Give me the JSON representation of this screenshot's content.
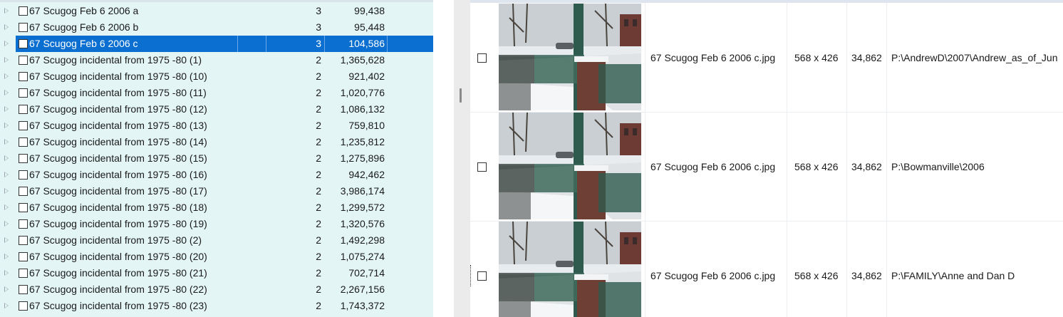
{
  "groups": [
    {
      "name": "67 Scugog Feb 6 2006 a",
      "count": "3",
      "size": "99,438",
      "selected": false
    },
    {
      "name": "67 Scugog Feb 6 2006 b",
      "count": "3",
      "size": "95,448",
      "selected": false
    },
    {
      "name": "67 Scugog Feb 6 2006 c",
      "count": "3",
      "size": "104,586",
      "selected": true
    },
    {
      "name": "67 Scugog incidental from 1975 -80 (1)",
      "count": "2",
      "size": "1,365,628",
      "selected": false
    },
    {
      "name": "67 Scugog incidental from 1975 -80 (10)",
      "count": "2",
      "size": "921,402",
      "selected": false
    },
    {
      "name": "67 Scugog incidental from 1975 -80 (11)",
      "count": "2",
      "size": "1,020,776",
      "selected": false
    },
    {
      "name": "67 Scugog incidental from 1975 -80 (12)",
      "count": "2",
      "size": "1,086,132",
      "selected": false
    },
    {
      "name": "67 Scugog incidental from 1975 -80 (13)",
      "count": "2",
      "size": "759,810",
      "selected": false
    },
    {
      "name": "67 Scugog incidental from 1975 -80 (14)",
      "count": "2",
      "size": "1,235,812",
      "selected": false
    },
    {
      "name": "67 Scugog incidental from 1975 -80 (15)",
      "count": "2",
      "size": "1,275,896",
      "selected": false
    },
    {
      "name": "67 Scugog incidental from 1975 -80 (16)",
      "count": "2",
      "size": "942,462",
      "selected": false
    },
    {
      "name": "67 Scugog incidental from 1975 -80 (17)",
      "count": "2",
      "size": "3,986,174",
      "selected": false
    },
    {
      "name": "67 Scugog incidental from 1975 -80 (18)",
      "count": "2",
      "size": "1,299,572",
      "selected": false
    },
    {
      "name": "67 Scugog incidental from 1975 -80 (19)",
      "count": "2",
      "size": "1,320,576",
      "selected": false
    },
    {
      "name": "67 Scugog incidental from 1975 -80 (2)",
      "count": "2",
      "size": "1,492,298",
      "selected": false
    },
    {
      "name": "67 Scugog incidental from 1975 -80 (20)",
      "count": "2",
      "size": "1,075,274",
      "selected": false
    },
    {
      "name": "67 Scugog incidental from 1975 -80 (21)",
      "count": "2",
      "size": "702,714",
      "selected": false
    },
    {
      "name": "67 Scugog incidental from 1975 -80 (22)",
      "count": "2",
      "size": "2,267,156",
      "selected": false
    },
    {
      "name": "67 Scugog incidental from 1975 -80 (23)",
      "count": "2",
      "size": "1,743,372",
      "selected": false
    }
  ],
  "files": [
    {
      "filename": "67 Scugog Feb 6 2006 c.jpg",
      "dimensions": "568 x 426",
      "size": "34,862",
      "path": "P:\\AndrewD\\2007\\Andrew_as_of_Jun",
      "focused": false
    },
    {
      "filename": "67 Scugog Feb 6 2006 c.jpg",
      "dimensions": "568 x 426",
      "size": "34,862",
      "path": "P:\\Bowmanville\\2006",
      "focused": false
    },
    {
      "filename": "67 Scugog Feb 6 2006 c.jpg",
      "dimensions": "568 x 426",
      "size": "34,862",
      "path": "P:\\FAMILY\\Anne and Dan D",
      "focused": true
    }
  ],
  "colors": {
    "tree_background": "#e3f5f5",
    "selection": "#0a6fd0",
    "splitter": "#ebebeb"
  },
  "icons": {
    "expander": "expand-arrow-icon",
    "checkbox": "checkbox-icon",
    "thumbnail": "photo-thumbnail"
  }
}
